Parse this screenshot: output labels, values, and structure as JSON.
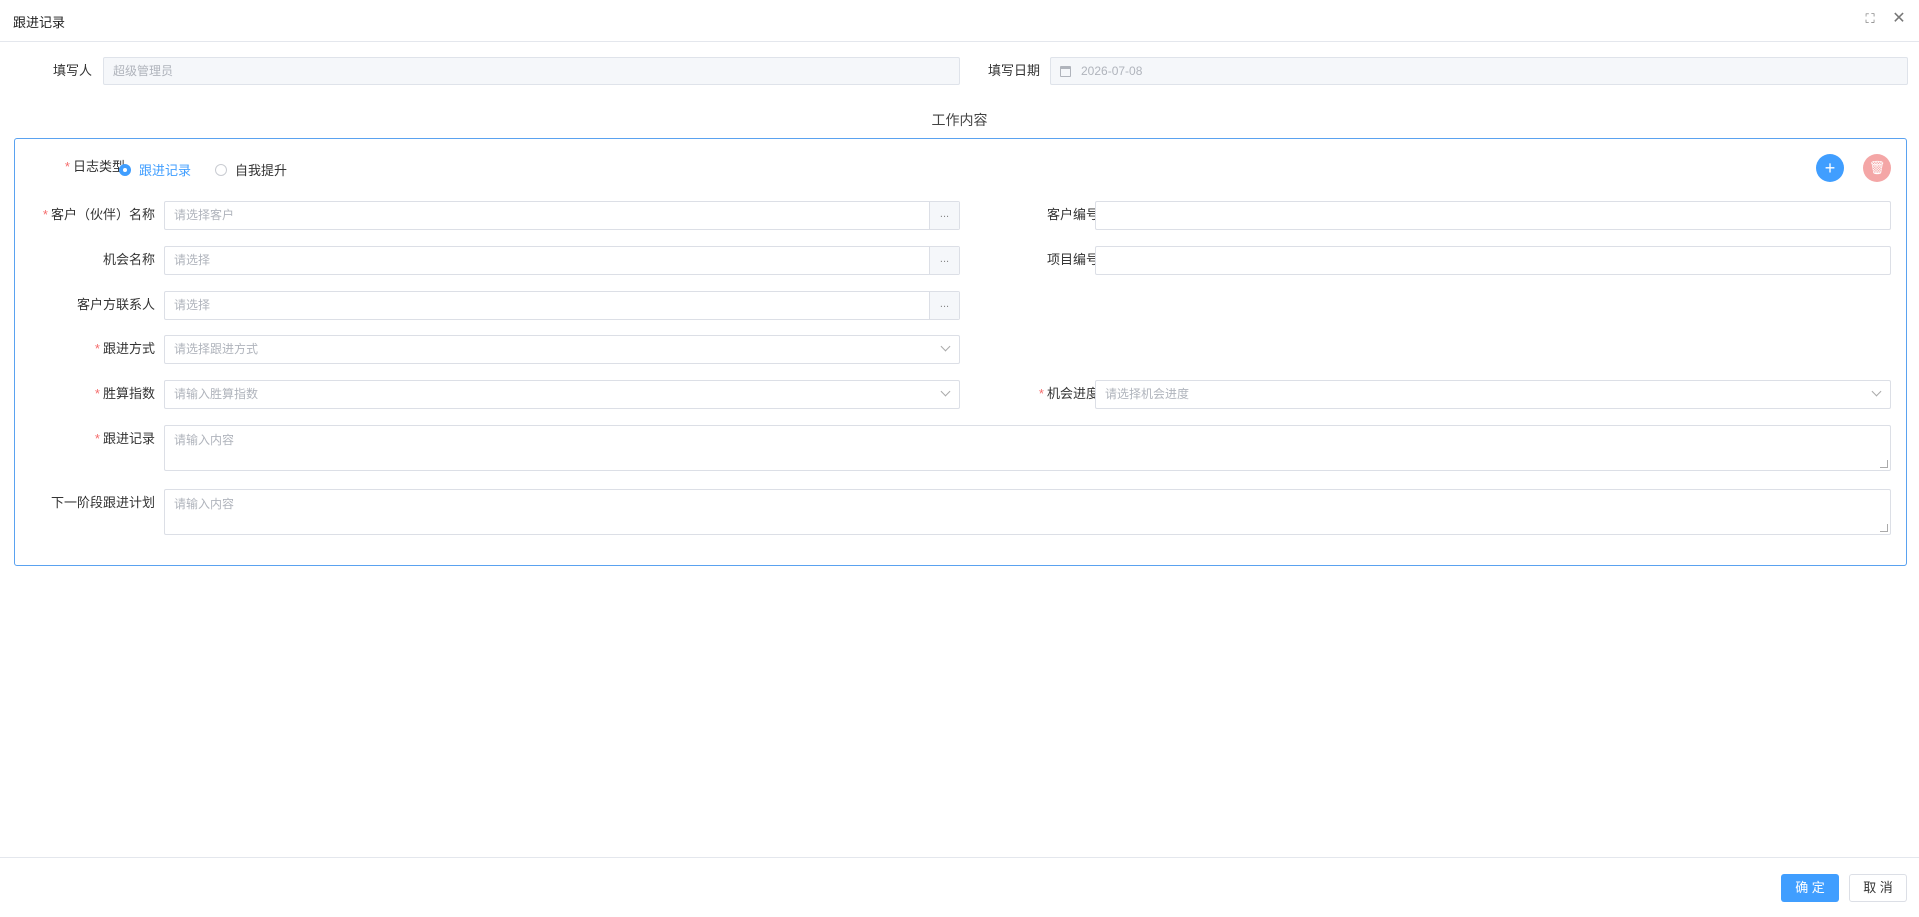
{
  "dialog": {
    "title": "跟进记录"
  },
  "header": {
    "fullscreen_icon": "fullscreen-icon",
    "close_icon": "close-icon"
  },
  "top": {
    "writer_label": "填写人",
    "writer_value": "超级管理员",
    "date_label": "填写日期",
    "date_value": "2026-07-08",
    "date_icon": "calendar-icon"
  },
  "section": {
    "title": "工作内容"
  },
  "log_type": {
    "label": "日志类型",
    "options": [
      {
        "label": "跟进记录",
        "checked": true
      },
      {
        "label": "自我提升",
        "checked": false
      }
    ]
  },
  "actions": {
    "add_icon": "plus-icon",
    "delete_icon": "trash-icon"
  },
  "fields": {
    "customer_label": "客户（伙伴）名称",
    "customer_placeholder": "请选择客户",
    "customer_no_label": "客户编号",
    "customer_no_value": "",
    "opportunity_label": "机会名称",
    "opportunity_placeholder": "请选择",
    "project_no_label": "项目编号",
    "project_no_value": "",
    "contact_label": "客户方联系人",
    "contact_placeholder": "请选择",
    "followup_method_label": "跟进方式",
    "followup_method_placeholder": "请选择跟进方式",
    "win_rate_label": "胜算指数",
    "win_rate_placeholder": "请输入胜算指数",
    "progress_label": "机会进度",
    "progress_placeholder": "请选择机会进度",
    "record_label": "跟进记录",
    "record_placeholder": "请输入内容",
    "next_plan_label": "下一阶段跟进计划",
    "next_plan_placeholder": "请输入内容",
    "picker_label": "..."
  },
  "footer": {
    "ok_label": "确 定",
    "cancel_label": "取 消"
  },
  "colors": {
    "accent": "#409eff",
    "required": "#f56c6c",
    "danger_light": "#f4a6a6",
    "panel_border": "#5aa2f0"
  }
}
